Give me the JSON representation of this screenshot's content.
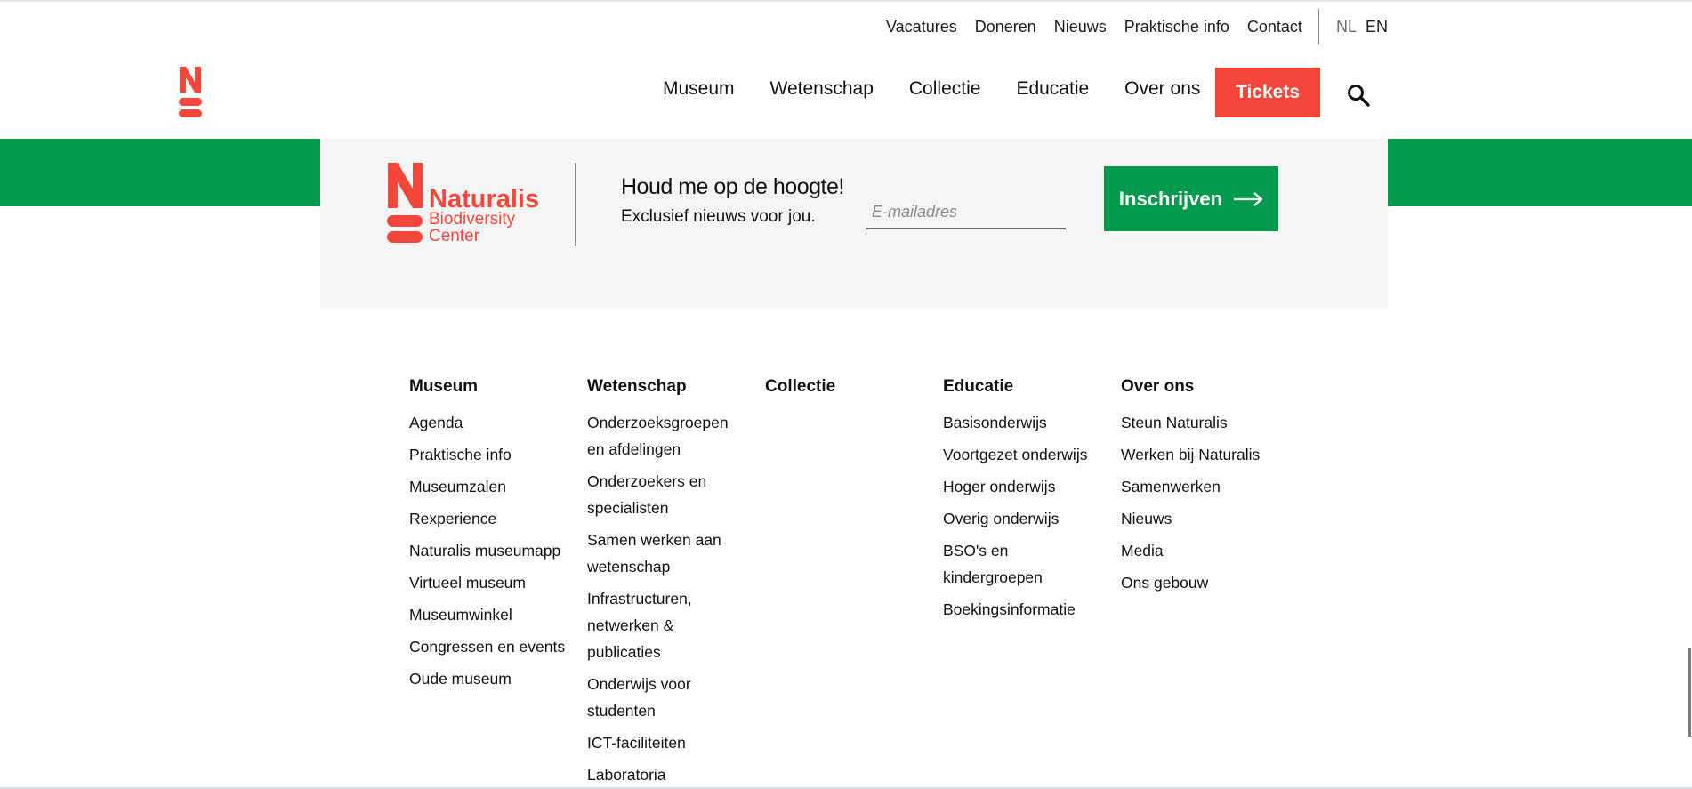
{
  "utility_nav": [
    "Vacatures",
    "Doneren",
    "Nieuws",
    "Praktische info",
    "Contact"
  ],
  "languages": [
    "NL",
    "EN"
  ],
  "main_nav": [
    "Museum",
    "Wetenschap",
    "Collectie",
    "Educatie",
    "Over ons"
  ],
  "tickets_label": "Tickets",
  "brand": {
    "name": "Naturalis",
    "line2": "Biodiversity",
    "line3": "Center"
  },
  "newsletter": {
    "title": "Houd me op de hoogte!",
    "subtitle": "Exclusief nieuws voor jou.",
    "email_placeholder": "E-mailadres",
    "subscribe_label": "Inschrijven"
  },
  "footer": [
    {
      "title": "Museum",
      "items": [
        "Agenda",
        "Praktische info",
        "Museumzalen",
        "Rexperience",
        "Naturalis museumapp",
        "Virtueel museum",
        "Museumwinkel",
        "Congressen en events",
        "Oude museum"
      ]
    },
    {
      "title": "Wetenschap",
      "items": [
        "Onderzoeksgroepen en afdelingen",
        "Onderzoekers en specialisten",
        "Samen werken aan wetenschap",
        "Infrastructuren, netwerken & publicaties",
        "Onderwijs voor studenten",
        "ICT-faciliteiten",
        "Laboratoria"
      ]
    },
    {
      "title": "Collectie",
      "items": []
    },
    {
      "title": "Educatie",
      "items": [
        "Basisonderwijs",
        "Voortgezet onderwijs",
        "Hoger onderwijs",
        "Overig onderwijs",
        "BSO's en kindergroepen",
        "Boekingsinformatie"
      ]
    },
    {
      "title": "Over ons",
      "items": [
        "Steun Naturalis",
        "Werken bij Naturalis",
        "Samenwerken",
        "Nieuws",
        "Media",
        "Ons gebouw"
      ]
    }
  ],
  "colors": {
    "accent_red": "#f5463c",
    "brand_green": "#029a4b",
    "panel_bg": "#f6f5f5"
  },
  "icons": {
    "search": "search-icon",
    "logo": "naturalis-logo",
    "arrow": "arrow-right-icon"
  }
}
